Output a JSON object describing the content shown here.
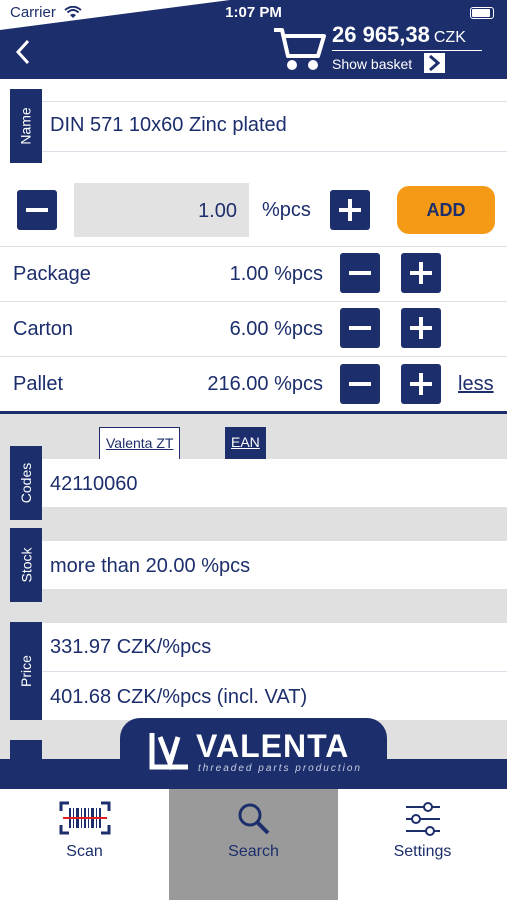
{
  "status_bar": {
    "carrier": "Carrier",
    "time": "1:07 PM"
  },
  "header": {
    "total": "26 965,38",
    "currency": "CZK",
    "show_basket": "Show basket"
  },
  "product": {
    "name_tab": "Name",
    "name": "DIN 571 10x60 Zinc plated"
  },
  "quantity": {
    "value": "1.00",
    "unit": "%pcs",
    "add_label": "ADD"
  },
  "packaging": [
    {
      "label": "Package",
      "value": "1.00 %pcs"
    },
    {
      "label": "Carton",
      "value": "6.00 %pcs"
    },
    {
      "label": "Pallet",
      "value": "216.00 %pcs"
    }
  ],
  "less_label": "less",
  "codes": {
    "tab_inactive": "Valenta ZT",
    "tab_active": "EAN",
    "label": "Codes",
    "value": "42110060"
  },
  "stock": {
    "label": "Stock",
    "value": "more than 20.00 %pcs"
  },
  "price": {
    "label": "Price",
    "net": "331.97 CZK/%pcs",
    "gross": "401.68 CZK/%pcs (incl. VAT)"
  },
  "logo": {
    "name": "VALENTA",
    "tagline": "threaded parts production"
  },
  "tabbar": [
    {
      "label": "Scan",
      "icon": "barcode-icon"
    },
    {
      "label": "Search",
      "icon": "search-icon"
    },
    {
      "label": "Settings",
      "icon": "sliders-icon"
    }
  ],
  "colors": {
    "navy": "#1c2e6b",
    "orange": "#f59a16",
    "grey": "#e0e0e0"
  }
}
